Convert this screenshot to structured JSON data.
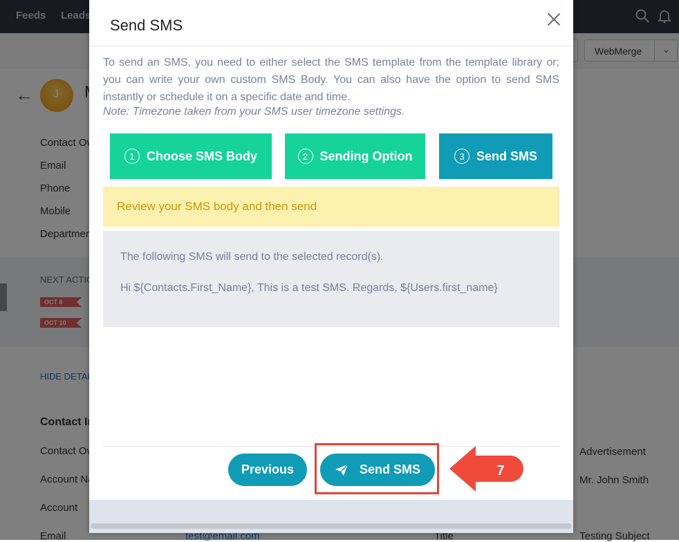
{
  "background": {
    "nav": {
      "feeds": "Feeds",
      "leads": "Leads"
    },
    "toolbar": {
      "webmerge": "WebMerge"
    },
    "record": {
      "initial": "J",
      "name_partial": "M",
      "fields_top": [
        "Contact Ov",
        "Email",
        "Phone",
        "Mobile",
        "Departmen"
      ],
      "next_action_label": "NEXT ACTIO",
      "dates": [
        "OCT 8",
        "OCT 10"
      ],
      "hide_details": "HIDE DETAIL",
      "section_title": "Contact In",
      "fields_bottom": [
        "Contact Ov",
        "Account Na",
        "Account",
        "Email"
      ],
      "email_value": "test@email.com",
      "title_label": "Title",
      "right_values": [
        "Advertisement",
        "Mr. John Smith",
        "Testing Subject"
      ]
    }
  },
  "modal": {
    "title": "Send SMS",
    "intro": "To send an SMS, you need to either select the SMS template from the template library or; you can write your own custom SMS Body. You can also have the option to send SMS instantly or schedule it on a specific date and time.",
    "note": "Note: Timezone taken from your SMS user timezone settings.",
    "steps": [
      {
        "num": "1",
        "label": "Choose SMS Body",
        "color": "#16d39a"
      },
      {
        "num": "2",
        "label": "Sending Option",
        "color": "#16d39a"
      },
      {
        "num": "3",
        "label": "Send SMS",
        "color": "#109cb6"
      }
    ],
    "review_banner": "Review your SMS body and then send",
    "sms_intro": "The following SMS will send to the selected record(s).",
    "sms_body": "Hi ${Contacts.First_Name}, This is a test SMS. Regards, ${Users.first_name}",
    "buttons": {
      "previous": "Previous",
      "send": "Send SMS"
    },
    "callout_number": "7"
  },
  "colors": {
    "accent": "#109cb6",
    "step_done": "#16d39a",
    "callout": "#f04a3a",
    "banner_text": "#c99800"
  }
}
